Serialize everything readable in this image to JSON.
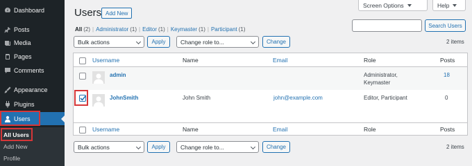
{
  "sidebar": {
    "items": [
      {
        "label": "Dashboard",
        "icon": "dashboard-icon"
      },
      {
        "label": "Posts",
        "icon": "pin-icon"
      },
      {
        "label": "Media",
        "icon": "media-icon"
      },
      {
        "label": "Pages",
        "icon": "pages-icon"
      },
      {
        "label": "Comments",
        "icon": "comments-icon"
      },
      {
        "label": "Appearance",
        "icon": "paintbrush-icon"
      },
      {
        "label": "Plugins",
        "icon": "plugins-icon"
      },
      {
        "label": "Users",
        "icon": "user-icon"
      }
    ],
    "submenu": [
      "All Users",
      "Add New",
      "Profile"
    ]
  },
  "header": {
    "title": "Users",
    "add_new": "Add New",
    "screen_options": "Screen Options",
    "help": "Help"
  },
  "filters": {
    "all": "All",
    "all_count": "(2)",
    "administrator": "Administrator",
    "administrator_count": "(1)",
    "editor": "Editor",
    "editor_count": "(1)",
    "keymaster": "Keymaster",
    "keymaster_count": "(1)",
    "participant": "Participant",
    "participant_count": "(1)",
    "separator": "|"
  },
  "search": {
    "button": "Search Users"
  },
  "bulk": {
    "bulk_actions": "Bulk actions",
    "apply": "Apply",
    "change_role": "Change role to...",
    "change": "Change",
    "items": "2 items"
  },
  "table": {
    "columns": {
      "username": "Username",
      "name": "Name",
      "email": "Email",
      "role": "Role",
      "posts": "Posts"
    },
    "rows": [
      {
        "username": "admin",
        "name": "",
        "email": "",
        "role_line1": "Administrator,",
        "role_line2": "Keymaster",
        "posts": "18",
        "checked": false
      },
      {
        "username": "JohnSmith",
        "name": "John Smith",
        "email": "john@example.com",
        "role_line1": "Editor, Participant",
        "role_line2": "",
        "posts": "0",
        "checked": true
      }
    ]
  },
  "colors": {
    "accent": "#2271b1",
    "sidebar": "#1d2327",
    "highlight": "#d63638"
  }
}
